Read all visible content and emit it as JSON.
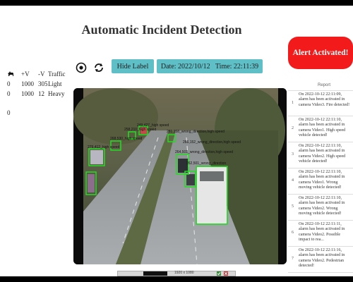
{
  "app": {
    "title": "Automatic Incident Detection"
  },
  "alert": {
    "label": "Alert Activated!",
    "color": "#f21a1a"
  },
  "stats": {
    "header_icon": "dog-icon",
    "columns": [
      "+V",
      "-V",
      "Traffic"
    ],
    "rows": [
      {
        "id": "0",
        "plus_v": "1000",
        "minus_v": "305",
        "traffic": "Light"
      },
      {
        "id": "0",
        "plus_v": "1000",
        "minus_v": "12",
        "traffic": "Heavy"
      }
    ],
    "extra": "0"
  },
  "controls": {
    "record_icon": "record-icon",
    "refresh_icon": "refresh-icon",
    "hide_label": "Hide Label",
    "datetime": "Date: 2022/10/12   Time: 22:11:39",
    "accent": "#5fbfc6"
  },
  "video": {
    "detections": [
      "279,412_high speed",
      "268,530_high speed",
      "258,210_high speed",
      "249,427_high speed",
      "281,158_wrong_direction,high speed",
      "286,152_wrong_direction,high speed",
      "264,501_wrong_direction,high speed",
      "262,501_wrong_direction"
    ],
    "box_color": "#22dd22"
  },
  "report": {
    "title": "Report",
    "items": [
      {
        "num": "1",
        "text": "On 2022-10-12 22:11:09, alarm has been activated in camera Video3. Fire detected!"
      },
      {
        "num": "2",
        "text": "On 2022-10-12 22:11:10, alarm has been activated in camera Video1. High speed vehicle detected!"
      },
      {
        "num": "3",
        "text": "On 2022-10-12 22:11:10, alarm has been activated in camera Video2. High speed vehicle detected!"
      },
      {
        "num": "4",
        "text": "On 2022-10-12 22:11:10, alarm has been activated in camera Video1. Wrong moving vehicle detected!"
      },
      {
        "num": "5",
        "text": "On 2022-10-12 22:11:10, alarm has been activated in camera Video2. Wrong moving vehicle detected!"
      },
      {
        "num": "6",
        "text": "On 2022-10-12 22:11:11, alarm has been activated in camera Video2. Possible impact to rea..."
      },
      {
        "num": "7",
        "text": "On 2022-10-12 22:11:16, alarm has been activated in camera Video2. Pedestrian detected!"
      }
    ]
  },
  "taskbar": {
    "text": "1920 x 1080"
  }
}
